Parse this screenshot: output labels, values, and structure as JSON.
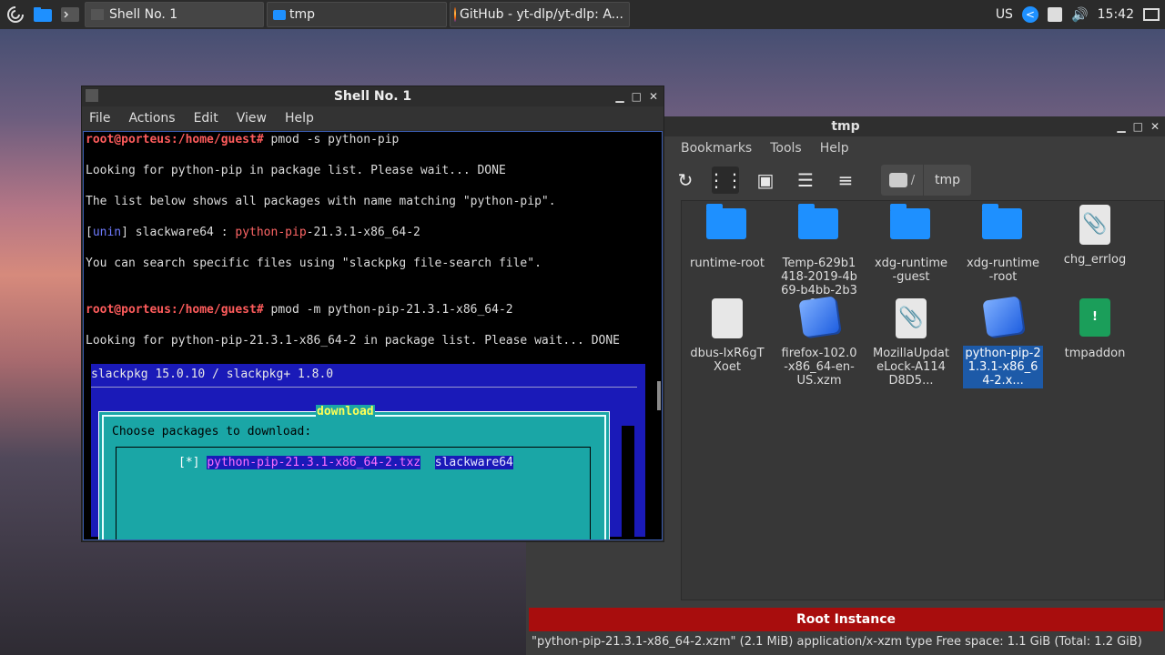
{
  "taskbar": {
    "tasks": [
      {
        "label": "Shell No. 1"
      },
      {
        "label": "tmp"
      },
      {
        "label": "GitHub - yt-dlp/yt-dlp: A..."
      }
    ],
    "tray": {
      "layout": "US",
      "clock": "15:42"
    }
  },
  "terminal": {
    "title": "Shell No. 1",
    "menu": [
      "File",
      "Actions",
      "Edit",
      "View",
      "Help"
    ],
    "lines": {
      "l1_prompt": "root@porteus:/home/guest#",
      "l1_cmd": " pmod -s python-pip",
      "l2": "Looking for python-pip in package list. Please wait... DONE",
      "l3": "The list below shows all packages with name matching \"python-pip\".",
      "l4_a": "[",
      "l4_b": "unin",
      "l4_c": "] slackware64 : ",
      "l4_d": "python-pip",
      "l4_e": "-21.3.1-x86_64-2",
      "l5": "You can search specific files using \"slackpkg file-search file\".",
      "l6_prompt": "root@porteus:/home/guest#",
      "l6_cmd": " pmod -m python-pip-21.3.1-x86_64-2",
      "l7": "Looking for python-pip-21.3.1-x86_64-2 in package list. Please wait... DONE"
    },
    "dialog": {
      "header": "slackpkg 15.0.10 / slackpkg+ 1.8.0",
      "title": "download",
      "prompt": "Choose packages to download:",
      "checkbox": "[*]",
      "package": "python-pip-21.3.1-x86_64-2.txz",
      "repo": "slackware64"
    }
  },
  "filemanager": {
    "title": "tmp",
    "menu": [
      "Bookmarks",
      "Tools",
      "Help"
    ],
    "breadcrumb": {
      "root": "/",
      "current": "tmp"
    },
    "files": [
      {
        "name": "runtime-root",
        "type": "folder"
      },
      {
        "name": "Temp-629b1418-2019-4b69-b4bb-2b32...",
        "type": "folder"
      },
      {
        "name": "xdg-runtime-guest",
        "type": "folder"
      },
      {
        "name": "xdg-runtime-root",
        "type": "folder"
      },
      {
        "name": "chg_errlog",
        "type": "doc"
      },
      {
        "name": "dbus-IxR6gTXoet",
        "type": "blank"
      },
      {
        "name": "firefox-102.0-x86_64-en-US.xzm",
        "type": "pkg"
      },
      {
        "name": "MozillaUpdateLock-A114D8D5...",
        "type": "doc"
      },
      {
        "name": "python-pip-21.3.1-x86_64-2.x...",
        "type": "pkg",
        "selected": true
      },
      {
        "name": "tmpaddon",
        "type": "zip"
      }
    ],
    "banner": "Root Instance",
    "status": "\"python-pip-21.3.1-x86_64-2.xzm\" (2.1 MiB) application/x-xzm type   Free space: 1.1 GiB (Total: 1.2 GiB)"
  }
}
